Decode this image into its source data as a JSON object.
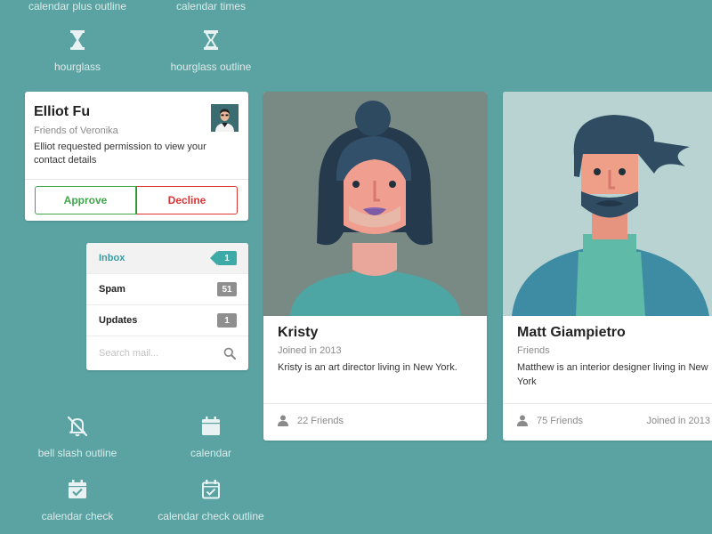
{
  "icons": {
    "calendar_plus_outline": "calendar plus outline",
    "calendar_times": "calendar times",
    "hourglass": "hourglass",
    "hourglass_outline": "hourglass outline",
    "bell_slash_outline": "bell slash outline",
    "calendar": "calendar",
    "calendar_check": "calendar check",
    "calendar_check_outline": "calendar check outline"
  },
  "feed": {
    "name": "Elliot Fu",
    "meta": "Friends of Veronika",
    "description": "Elliot requested permission to view your contact details",
    "approve_label": "Approve",
    "decline_label": "Decline"
  },
  "mail": {
    "items": [
      {
        "label": "Inbox",
        "count": "1"
      },
      {
        "label": "Spam",
        "count": "51"
      },
      {
        "label": "Updates",
        "count": "1"
      }
    ],
    "search_placeholder": "Search mail..."
  },
  "cards": [
    {
      "name": "Kristy",
      "meta": "Joined in 2013",
      "description": "Kristy is an art director living in New York.",
      "friends": "22 Friends"
    },
    {
      "name": "Matt Giampietro",
      "meta": "Friends",
      "description": "Matthew is an interior designer living in New York",
      "friends": "75 Friends",
      "joined": "Joined in 2013"
    }
  ],
  "colors": {
    "background": "#5aa3a2",
    "approve": "#3fa64a",
    "decline": "#dd3333",
    "accent": "#3daaa8"
  }
}
